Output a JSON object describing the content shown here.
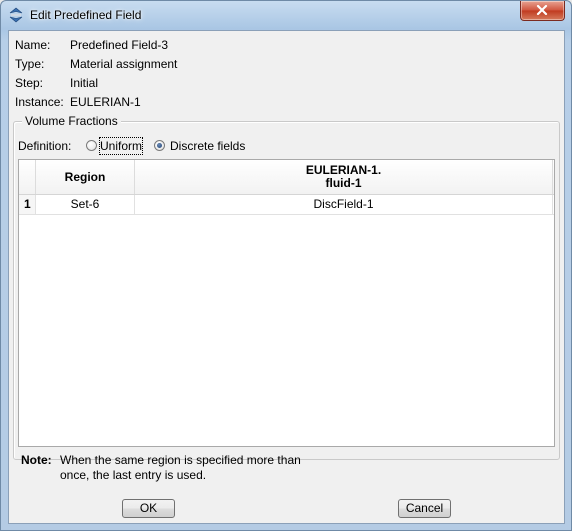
{
  "window": {
    "title": "Edit Predefined Field"
  },
  "info": [
    {
      "label": "Name:",
      "value": "Predefined Field-3"
    },
    {
      "label": "Type:",
      "value": "Material assignment"
    },
    {
      "label": "Step:",
      "value": "Initial"
    },
    {
      "label": "Instance:",
      "value": "EULERIAN-1"
    }
  ],
  "group": {
    "title": "Volume Fractions",
    "definition_label": "Definition:",
    "options": [
      {
        "label": "Uniform",
        "selected": false
      },
      {
        "label": "Discrete fields",
        "selected": true
      }
    ]
  },
  "table": {
    "columns": [
      "",
      "Region",
      "EULERIAN-1.",
      "fluid-1"
    ],
    "rows": [
      {
        "index": "1",
        "region": "Set-6",
        "value": "DiscField-1"
      }
    ]
  },
  "note": {
    "label": "Note:",
    "text": "When the same region is specified more than once, the last entry is used."
  },
  "buttons": {
    "ok": "OK",
    "cancel": "Cancel"
  },
  "colors": {
    "title_bar": "#b4cbe4",
    "close_button": "#c9482c",
    "client_bg": "#f0f0f0"
  }
}
